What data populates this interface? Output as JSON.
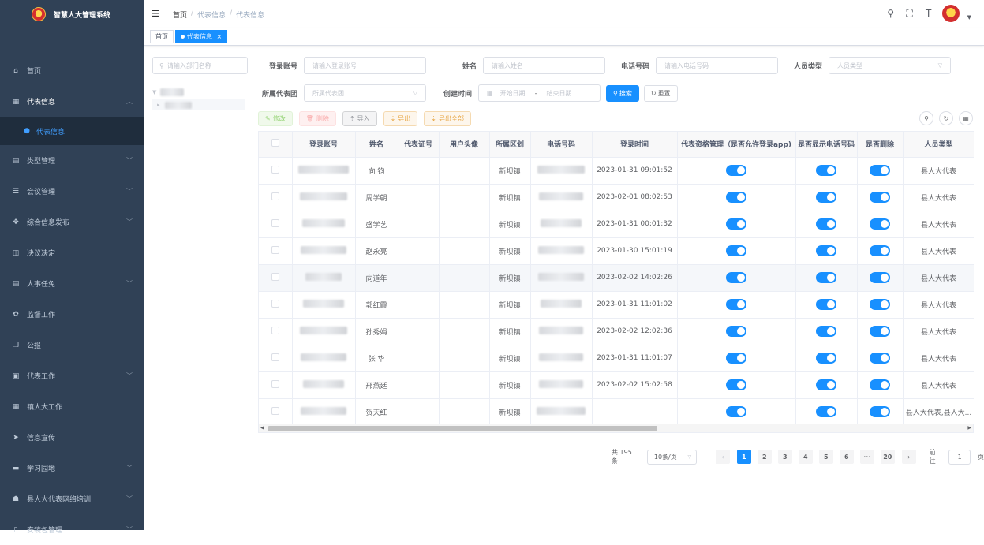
{
  "app": {
    "title": "智慧人大管理系统"
  },
  "sidebar": {
    "items": [
      {
        "label": "首页",
        "icon": "dashboard-icon",
        "glyph": "⌂",
        "arrow": false
      },
      {
        "label": "代表信息",
        "icon": "grid-icon",
        "glyph": "▦",
        "arrow": true,
        "open": true
      },
      {
        "label": "类型管理",
        "icon": "document-icon",
        "glyph": "▤",
        "arrow": true
      },
      {
        "label": "会议管理",
        "icon": "list-icon",
        "glyph": "☰",
        "arrow": true
      },
      {
        "label": "综合信息发布",
        "icon": "move-icon",
        "glyph": "✥",
        "arrow": true
      },
      {
        "label": "决议决定",
        "icon": "book-icon",
        "glyph": "◫",
        "arrow": false
      },
      {
        "label": "人事任免",
        "icon": "document-icon",
        "glyph": "▤",
        "arrow": true
      },
      {
        "label": "监督工作",
        "icon": "gear-icon",
        "glyph": "✿",
        "arrow": false
      },
      {
        "label": "公报",
        "icon": "copy-icon",
        "glyph": "❐",
        "arrow": false
      },
      {
        "label": "代表工作",
        "icon": "print-icon",
        "glyph": "▣",
        "arrow": true
      },
      {
        "label": "镇人大工作",
        "icon": "table-icon",
        "glyph": "▦",
        "arrow": false
      },
      {
        "label": "信息宣传",
        "icon": "send-icon",
        "glyph": "➤",
        "arrow": false
      },
      {
        "label": "学习园地",
        "icon": "folder-icon",
        "glyph": "▬",
        "arrow": true
      },
      {
        "label": "县人大代表网络培训",
        "icon": "people-icon",
        "glyph": "☗",
        "arrow": true
      },
      {
        "label": "安装包管理",
        "icon": "phone-icon",
        "glyph": "▯",
        "arrow": true
      }
    ],
    "submenu": {
      "label": "代表信息"
    }
  },
  "header": {
    "breadcrumb": [
      "首页",
      "代表信息",
      "代表信息"
    ],
    "icons": [
      "search-icon",
      "fullscreen-icon",
      "font-size-icon"
    ]
  },
  "tags": [
    {
      "label": "首页"
    },
    {
      "label": "代表信息",
      "close": "×"
    }
  ],
  "tree": {
    "search_placeholder": "请输入部门名称"
  },
  "form": {
    "account_label": "登录账号",
    "account_placeholder": "请输入登录账号",
    "name_label": "姓名",
    "name_placeholder": "请输入姓名",
    "phone_label": "电话号码",
    "phone_placeholder": "请输入电话号码",
    "type_label": "人员类型",
    "type_placeholder": "人员类型",
    "group_label": "所属代表团",
    "group_placeholder": "所属代表团",
    "created_label": "创建时间",
    "start_placeholder": "开始日期",
    "range_sep": "-",
    "end_placeholder": "结束日期",
    "search_button": "搜索",
    "reset_button": "重置"
  },
  "toolbar": {
    "edit": "修改",
    "delete": "删除",
    "import": "导入",
    "export": "导出",
    "export_all": "导出全部"
  },
  "table": {
    "headers": [
      "登录账号",
      "姓名",
      "代表证号",
      "用户头像",
      "所属区划",
      "电话号码",
      "登录时间",
      "代表资格管理（是否允许登录app)",
      "是否显示电话号码",
      "是否删除",
      "人员类型"
    ],
    "rows": [
      {
        "name": "向 钧",
        "region": "新坝镇",
        "login_time": "2023-01-31 09:01:52",
        "type": "县人大代表"
      },
      {
        "name": "周学朝",
        "region": "新坝镇",
        "login_time": "2023-02-01 08:02:53",
        "type": "县人大代表"
      },
      {
        "name": "盛学艺",
        "region": "新坝镇",
        "login_time": "2023-01-31 00:01:32",
        "type": "县人大代表"
      },
      {
        "name": "赵永亮",
        "region": "新坝镇",
        "login_time": "2023-01-30 15:01:19",
        "type": "县人大代表"
      },
      {
        "name": "向道年",
        "region": "新坝镇",
        "login_time": "2023-02-02 14:02:26",
        "type": "县人大代表"
      },
      {
        "name": "郭红霞",
        "region": "新坝镇",
        "login_time": "2023-01-31 11:01:02",
        "type": "县人大代表"
      },
      {
        "name": "孙秀娟",
        "region": "新坝镇",
        "login_time": "2023-02-02 12:02:36",
        "type": "县人大代表"
      },
      {
        "name": "张 华",
        "region": "新坝镇",
        "login_time": "2023-01-31 11:01:07",
        "type": "县人大代表"
      },
      {
        "name": "邢燕廷",
        "region": "新坝镇",
        "login_time": "2023-02-02 15:02:58",
        "type": "县人大代表"
      },
      {
        "name": "贺天红",
        "region": "新坝镇",
        "login_time": "",
        "type": "县人大代表,县人大..."
      }
    ]
  },
  "pagination": {
    "total": "共 195 条",
    "page_size": "10条/页",
    "pages": [
      "1",
      "2",
      "3",
      "4",
      "5",
      "6",
      "···",
      "20"
    ],
    "goto_label": "前往",
    "goto_value": "1",
    "goto_suffix": "页"
  },
  "colors": {
    "sidebar_bg": "#304156",
    "primary": "#1890ff",
    "submenu_bg": "#1f2d3d"
  }
}
